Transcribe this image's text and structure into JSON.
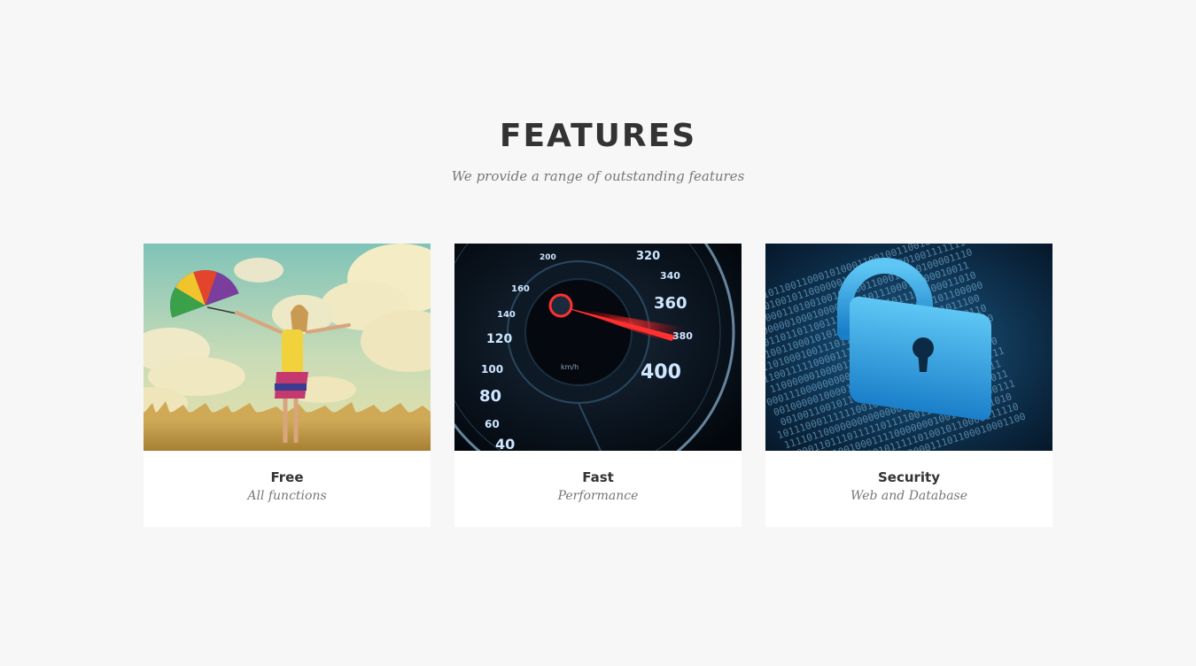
{
  "section": {
    "title": "FEATURES",
    "subtitle": "We provide a range of outstanding features"
  },
  "cards": [
    {
      "title": "Free",
      "subtitle": "All functions",
      "image": "woman-with-umbrella-in-field-image"
    },
    {
      "title": "Fast",
      "subtitle": "Performance",
      "image": "speedometer-image",
      "speedometer_labels": [
        "320",
        "340",
        "360",
        "380",
        "400",
        "200",
        "160",
        "140",
        "120",
        "100",
        "80",
        "60",
        "40"
      ],
      "speedometer_unit": "km/h"
    },
    {
      "title": "Security",
      "subtitle": "Web and Database",
      "image": "padlock-on-binary-code-image"
    }
  ],
  "colors": {
    "background": "#f7f7f7",
    "card": "#ffffff",
    "heading": "#333333",
    "muted": "#777777"
  }
}
